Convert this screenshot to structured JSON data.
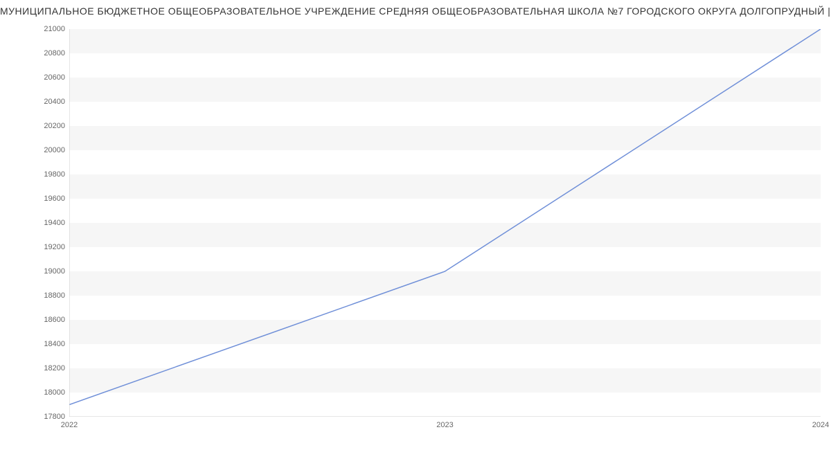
{
  "chart_data": {
    "type": "line",
    "title": "МУНИЦИПАЛЬНОЕ БЮДЖЕТНОЕ ОБЩЕОБРАЗОВАТЕЛЬНОЕ УЧРЕЖДЕНИЕ СРЕДНЯЯ ОБЩЕОБРАЗОВАТЕЛЬНАЯ ШКОЛА №7 ГОРОДСКОГО ОКРУГА ДОЛГОПРУДНЫЙ | Данные",
    "x": [
      2022,
      2023,
      2024
    ],
    "values": [
      17900,
      19000,
      21000
    ],
    "x_ticks": [
      "2022",
      "2023",
      "2024"
    ],
    "y_ticks": [
      17800,
      18000,
      18200,
      18400,
      18600,
      18800,
      19000,
      19200,
      19400,
      19600,
      19800,
      20000,
      20200,
      20400,
      20600,
      20800,
      21000
    ],
    "ylim": [
      17800,
      21000
    ],
    "line_color": "#6f8fd8",
    "band_fill": "#f6f6f6",
    "axis_color": "#cccccc",
    "label_color": "#666666"
  }
}
